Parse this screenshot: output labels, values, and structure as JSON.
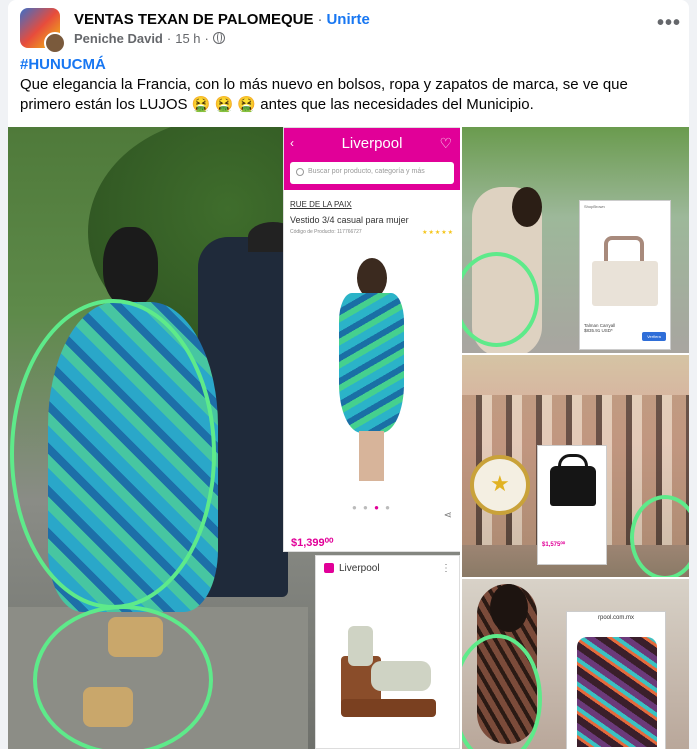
{
  "post": {
    "group_name": "VENTAS TEXAN DE PALOMEQUE",
    "join_label": "Unirte",
    "author": "Peniche David",
    "time": "15 h",
    "more_icon": "more-options-icon",
    "hashtag": "#HUNUCMÁ",
    "text": "Que elegancia la Francia, con lo más nuevo en  bolsos, ropa y zapatos de marca, se ve que primero están los LUJOS 🤮 🤮 🤮 antes que las necesidades del Municipio."
  },
  "photos": {
    "liverpool_dress": {
      "store": "Liverpool",
      "search_placeholder": "Buscar por producto, categoría y más",
      "brand": "RUE DE LA PAIX",
      "title": "Vestido 3/4 casual para mujer",
      "code": "Código de Producto: 117766727",
      "stars": "★★★★★",
      "price": "$1,399⁰⁰"
    },
    "liverpool_sandal": {
      "store": "Liverpool"
    },
    "bag_card": {
      "store": "ShopBrown",
      "name": "Talman Carryall",
      "price": "$835.91 USD*",
      "button": "Verfiera"
    },
    "bag3": {
      "price": "$1,575⁰⁰"
    },
    "shirt_card": {
      "url": "rpool.com.mx"
    }
  },
  "colors": {
    "accent": "#1877f2",
    "liverpool": "#e10098",
    "circle": "#5eea8a"
  }
}
